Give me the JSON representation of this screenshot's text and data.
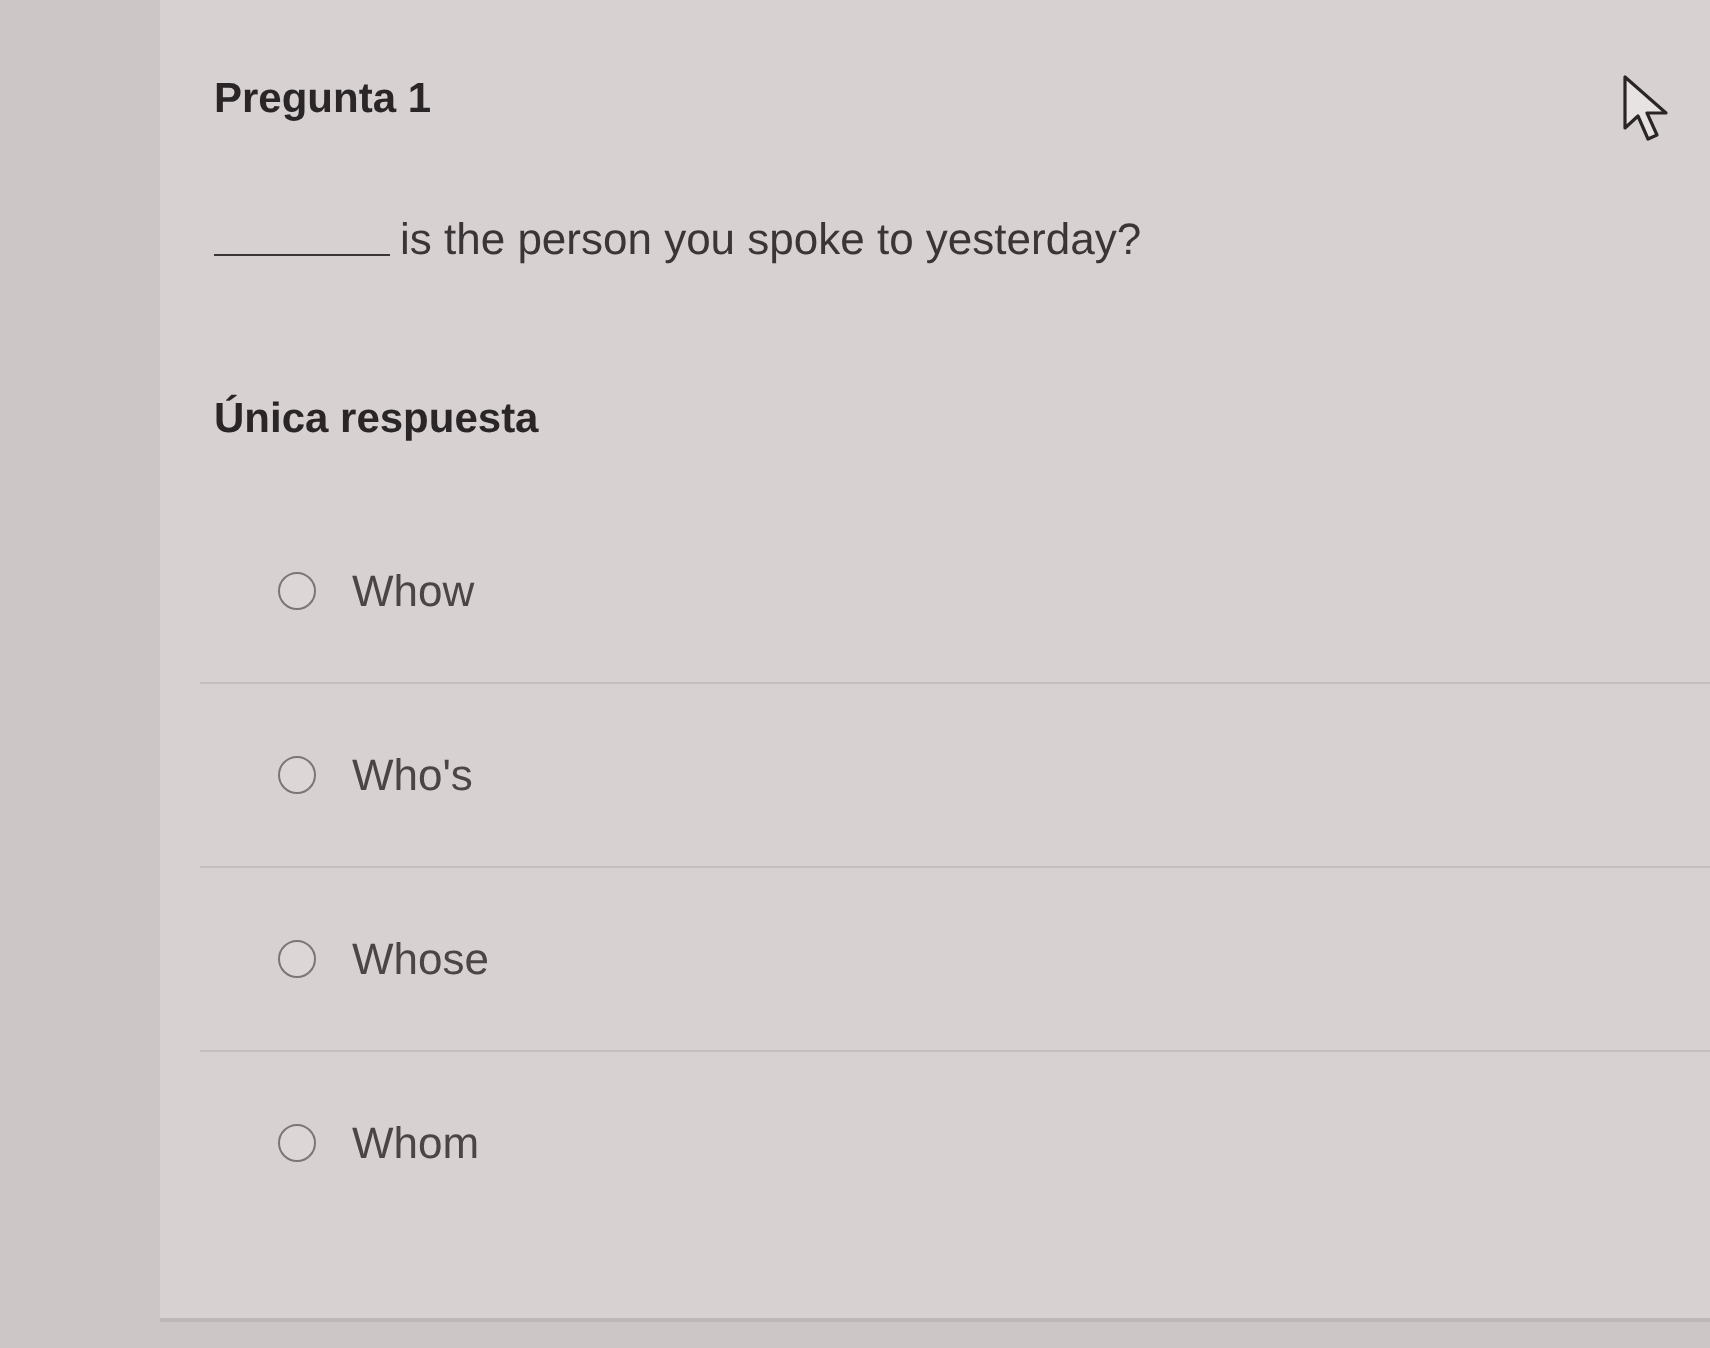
{
  "question": {
    "title": "Pregunta 1",
    "text": "is the person you spoke to yesterday?"
  },
  "answer_type": "Única respuesta",
  "options": [
    {
      "label": "Whow",
      "selected": false
    },
    {
      "label": "Who's",
      "selected": false
    },
    {
      "label": "Whose",
      "selected": false
    },
    {
      "label": "Whom",
      "selected": false
    }
  ]
}
